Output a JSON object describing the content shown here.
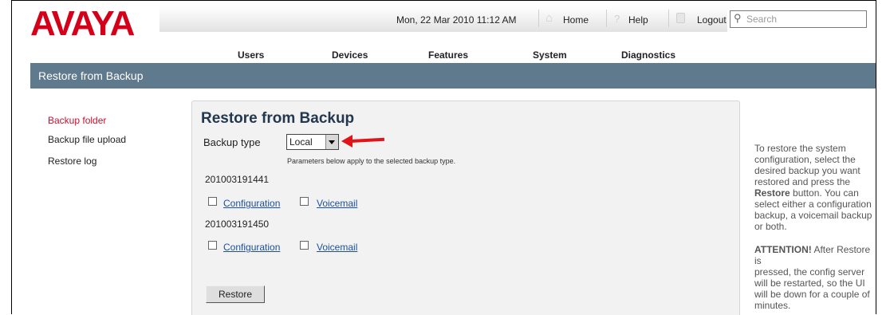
{
  "brand": {
    "logo": "AVAYA",
    "color": "#d4001a"
  },
  "topbar": {
    "datetime": "Mon, 22 Mar 2010 11:12 AM",
    "links": [
      {
        "label": "Home",
        "icon": "home-icon"
      },
      {
        "label": "Help",
        "icon": "help-icon"
      },
      {
        "label": "Logout",
        "icon": "lock-icon"
      }
    ],
    "search": {
      "placeholder": "Search",
      "icon": "search-icon"
    }
  },
  "nav": [
    "Users",
    "Devices",
    "Features",
    "System",
    "Diagnostics"
  ],
  "page_title": "Restore from Backup",
  "sidebar": {
    "items": [
      {
        "label": "Backup folder",
        "active": true
      },
      {
        "label": "Backup file upload",
        "active": false
      },
      {
        "label": "Restore log",
        "active": false
      }
    ]
  },
  "main": {
    "title": "Restore from Backup",
    "backup_type_label": "Backup type",
    "backup_type_value": "Local",
    "hint": "Parameters below apply to the selected backup type.",
    "backups": [
      {
        "id": "201003191441",
        "options": [
          "Configuration",
          "Voicemail"
        ]
      },
      {
        "id": "201003191450",
        "options": [
          "Configuration",
          "Voicemail"
        ]
      }
    ],
    "restore_label": "Restore"
  },
  "help": {
    "lines1": [
      "To restore the system",
      "configuration, select the",
      "desired backup you want",
      "restored and press the"
    ],
    "line_restore_bold": "Restore",
    "line_restore_rest": " button. You can",
    "lines2": [
      "select either a configuration",
      "backup, a voicemail backup",
      "or both."
    ],
    "attention_bold": "ATTENTION!",
    "attention_rest": " After Restore is",
    "lines3": [
      "pressed, the config server",
      "will be restarted, so the UI",
      "will be down for a couple of",
      "minutes."
    ]
  },
  "colors": {
    "title_bar": "#5f7a8c",
    "active_link": "#c8102e",
    "annotation_arrow": "#e0141b"
  }
}
